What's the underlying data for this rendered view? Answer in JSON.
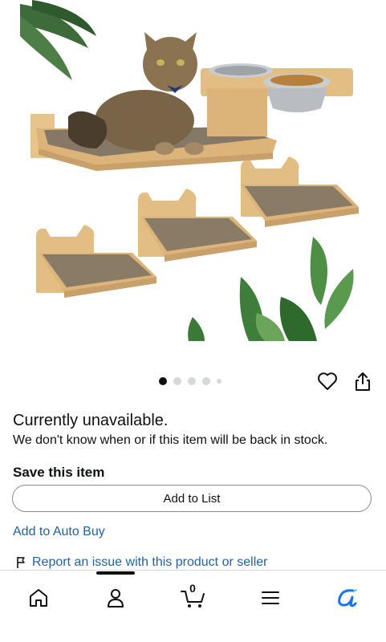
{
  "carousel": {
    "total_images": 5,
    "current_index": 1
  },
  "availability": {
    "title": "Currently unavailable.",
    "description": "We don't know when or if this item will be back in stock."
  },
  "save": {
    "title": "Save this item",
    "add_to_list_label": "Add to List"
  },
  "links": {
    "auto_buy": "Add to Auto Buy",
    "report": "Report an issue with this product or seller"
  },
  "bottom_nav": {
    "cart_count": "0",
    "items": [
      "home-icon",
      "account-icon",
      "cart-icon",
      "menu-icon",
      "ai-assistant-icon"
    ]
  },
  "colors": {
    "link": "#2162a1",
    "text": "#0f1111",
    "accent": "#1a73e8"
  }
}
